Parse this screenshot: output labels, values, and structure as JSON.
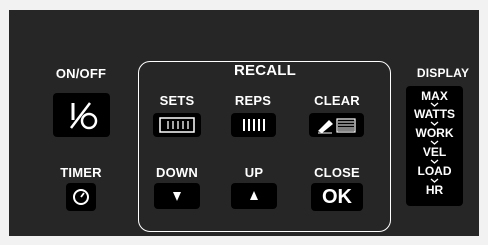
{
  "on_off": {
    "label": "ON/OFF",
    "icon": "power-toggle-icon"
  },
  "timer": {
    "label": "TIMER",
    "icon": "clock-icon"
  },
  "recall": {
    "title": "RECALL",
    "sets_label": "SETS",
    "reps_label": "REPS",
    "clear_label": "CLEAR",
    "down_label": "DOWN",
    "up_label": "UP",
    "close_label": "CLOSE",
    "ok_text": "OK"
  },
  "display": {
    "title": "DISPLAY",
    "items": [
      "MAX",
      "WATTS",
      "WORK",
      "VEL",
      "LOAD",
      "HR"
    ]
  },
  "colors": {
    "panel": "#262626",
    "button": "#000000",
    "text": "#ffffff",
    "background": "#f2f2f2"
  }
}
